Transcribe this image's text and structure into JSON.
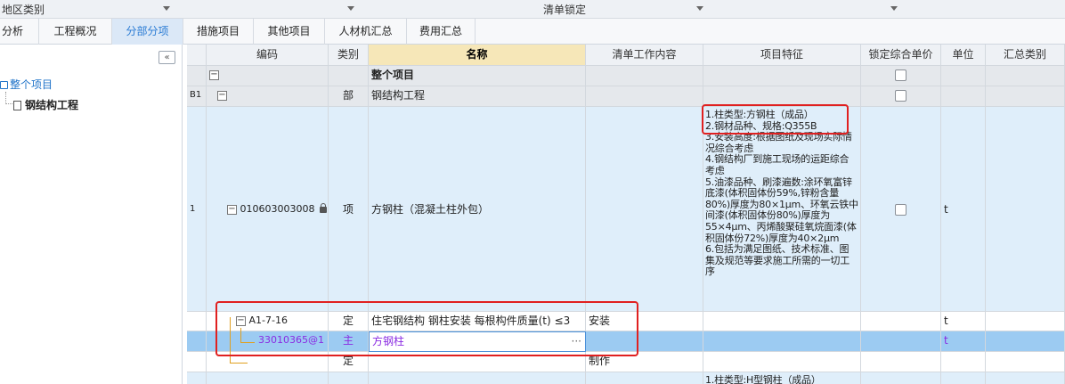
{
  "filterbar": {
    "region_label": "地区类别",
    "list_lock_label": "清单锁定"
  },
  "tabs": [
    {
      "label": "分析"
    },
    {
      "label": "工程概况"
    },
    {
      "label": "分部分项",
      "active": true
    },
    {
      "label": "措施项目"
    },
    {
      "label": "其他项目"
    },
    {
      "label": "人材机汇总"
    },
    {
      "label": "费用汇总"
    }
  ],
  "tree": {
    "collapse_label": "«",
    "root": "整个项目",
    "child": "钢结构工程"
  },
  "grid": {
    "headers": {
      "code": "编码",
      "type": "类别",
      "name": "名称",
      "work": "清单工作内容",
      "feature": "项目特征",
      "lock_price": "锁定综合单价",
      "unit": "单位",
      "summary_type": "汇总类别"
    },
    "rows": {
      "project": {
        "name": "整个项目"
      },
      "b1": {
        "seq": "B1",
        "type": "部",
        "name": "钢结构工程"
      },
      "item1": {
        "seq": "1",
        "code": "010603003008",
        "type": "项",
        "name": "方钢柱（混凝土柱外包）",
        "unit": "t",
        "features": [
          "1.柱类型:方钢柱（成品）",
          "2.钢材品种、规格:Q355B",
          "3.安装高度:根据图纸及现场实际情况综合考虑",
          "4.钢结构厂到施工现场的运距综合考虑",
          "5.油漆品种、刷漆遍数:涂环氧富锌底漆(体积固体份59%,锌粉含量80%)厚度为80×1μm、环氧云铁中间漆(体积固体份80%)厚度为55×4μm、丙烯酸聚硅氧烷面漆(体积固体份72%)厚度为40×2μm",
          "6.包括为满足图纸、技术标准、图集及规范等要求施工所需的一切工序"
        ]
      },
      "def1": {
        "code": "A1-7-16",
        "type": "定",
        "name": "住宅钢结构 钢柱安装 每根构件质量(t) ≤3",
        "work": "安装",
        "unit": "t"
      },
      "main1": {
        "code": "33010365@1",
        "type": "主",
        "name": "方钢柱",
        "unit": "t",
        "ellipsis": "···"
      },
      "def2": {
        "type": "定",
        "work": "制作"
      },
      "next_item": {
        "feature": "1.柱类型:H型钢柱（成品）"
      }
    }
  }
}
